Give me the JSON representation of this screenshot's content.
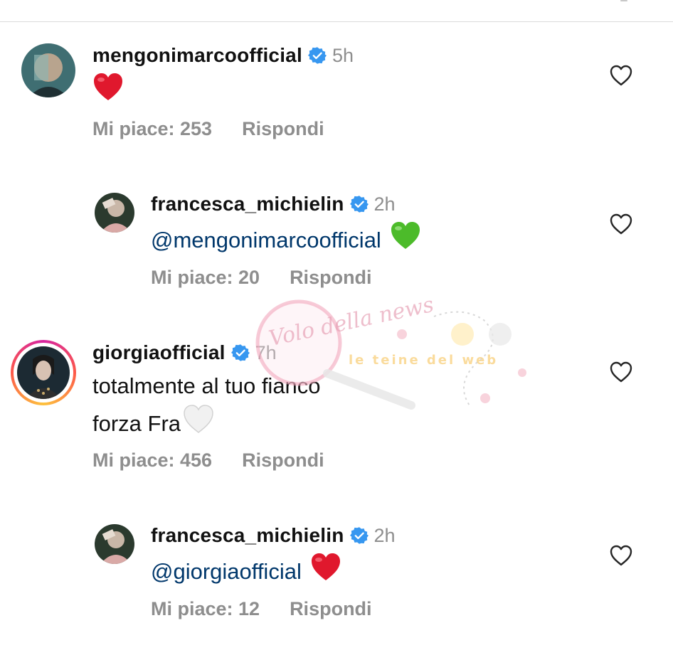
{
  "comments": [
    {
      "username": "mengonimarcoofficial",
      "time": "5h",
      "text_prefix": "",
      "text_lines": [],
      "emoji": "red-heart",
      "likes": "Mi piace: 253",
      "reply": "Rispondi"
    },
    {
      "username": "francesca_michielin",
      "time": "2h",
      "mention": "@mengonimarcoofficial",
      "emoji": "green-heart",
      "likes": "Mi piace: 20",
      "reply": "Rispondi"
    },
    {
      "username": "giorgiaofficial",
      "time": "7h",
      "text_line1": "totalmente al tuo fianco",
      "text_line2": "forza Fra",
      "emoji": "white-heart",
      "likes": "Mi piace: 456",
      "reply": "Rispondi"
    },
    {
      "username": "francesca_michielin",
      "time": "2h",
      "mention": "@giorgiaofficial",
      "emoji": "red-heart",
      "likes": "Mi piace: 12",
      "reply": "Rispondi"
    }
  ],
  "watermark": {
    "logo_text": "Volo della news",
    "banner_text": "le teine del web"
  },
  "colors": {
    "verified": "#3797f0",
    "mention": "#00376b",
    "meta": "#8e8e8e",
    "red_heart": "#e0182d",
    "green_heart": "#4cbb2a"
  }
}
